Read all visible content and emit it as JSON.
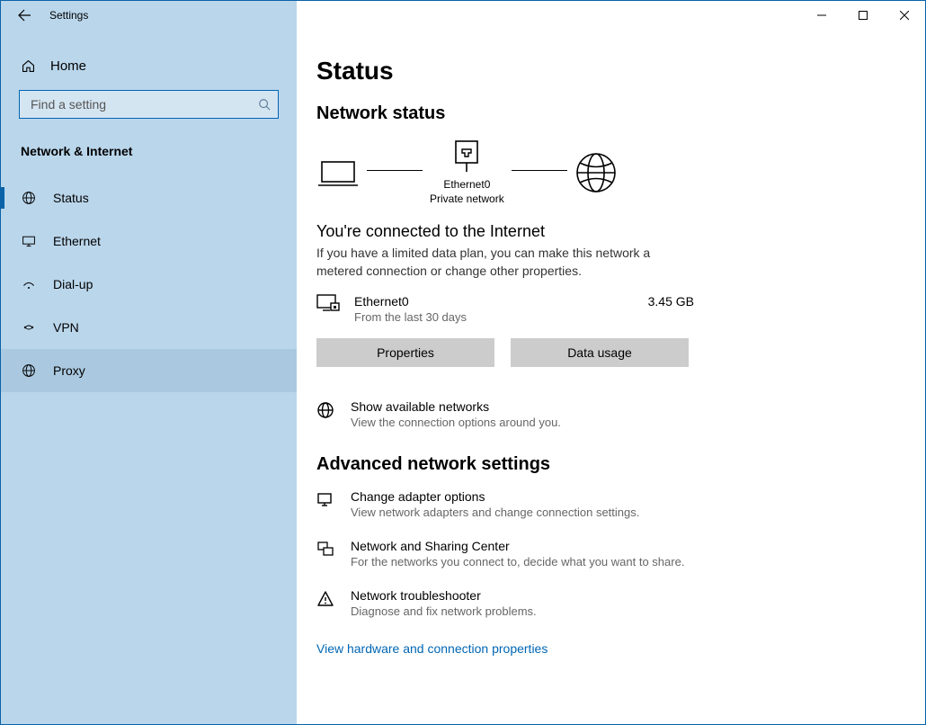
{
  "titlebar": {
    "app": "Settings"
  },
  "sidebar": {
    "home": "Home",
    "search_placeholder": "Find a setting",
    "category": "Network & Internet",
    "items": [
      {
        "label": "Status",
        "icon": "globe",
        "selected": true
      },
      {
        "label": "Ethernet",
        "icon": "monitor"
      },
      {
        "label": "Dial-up",
        "icon": "wifi"
      },
      {
        "label": "VPN",
        "icon": "vpn"
      },
      {
        "label": "Proxy",
        "icon": "globe",
        "hovered": true
      }
    ]
  },
  "main": {
    "title": "Status",
    "network_status": "Network status",
    "diagram": {
      "connection_name": "Ethernet0",
      "network_type": "Private network"
    },
    "connected_head": "You're connected to the Internet",
    "connected_desc": "If you have a limited data plan, you can make this network a metered connection or change other properties.",
    "adapter": {
      "name": "Ethernet0",
      "sub": "From the last 30 days",
      "usage": "3.45 GB"
    },
    "buttons": {
      "properties": "Properties",
      "data_usage": "Data usage"
    },
    "show_networks": {
      "title": "Show available networks",
      "sub": "View the connection options around you."
    },
    "advanced_title": "Advanced network settings",
    "change_adapter": {
      "title": "Change adapter options",
      "sub": "View network adapters and change connection settings."
    },
    "sharing": {
      "title": "Network and Sharing Center",
      "sub": "For the networks you connect to, decide what you want to share."
    },
    "troubleshooter": {
      "title": "Network troubleshooter",
      "sub": "Diagnose and fix network problems."
    },
    "hw_link": "View hardware and connection properties"
  }
}
